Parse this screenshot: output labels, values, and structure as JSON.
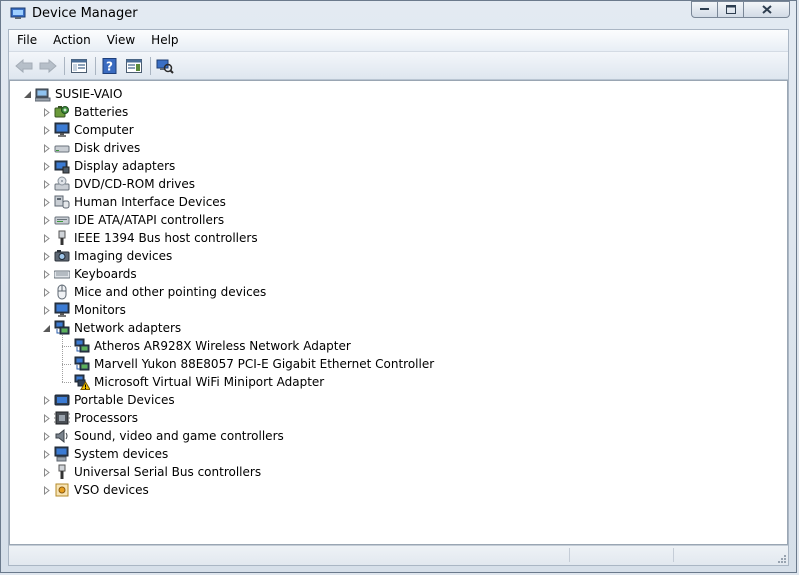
{
  "window": {
    "title": "Device Manager"
  },
  "menu": [
    "File",
    "Action",
    "View",
    "Help"
  ],
  "toolbar": {
    "buttons": [
      {
        "name": "back-button",
        "icon": "back-arrow-icon",
        "enabled": false
      },
      {
        "name": "forward-button",
        "icon": "forward-arrow-icon",
        "enabled": false
      },
      {
        "name": "show-hide-console-tree-button",
        "icon": "console-tree-icon",
        "enabled": true
      },
      {
        "name": "help-button",
        "icon": "help-icon",
        "enabled": true
      },
      {
        "name": "show-action-pane-button",
        "icon": "properties-icon",
        "enabled": true
      },
      {
        "name": "scan-hardware-button",
        "icon": "scan-hardware-icon",
        "enabled": true
      }
    ]
  },
  "tree": {
    "root": {
      "label": "SUSIE-VAIO",
      "icon": "computer-icon",
      "expanded": true
    },
    "categories": [
      {
        "label": "Batteries",
        "icon": "battery-icon"
      },
      {
        "label": "Computer",
        "icon": "monitor-icon"
      },
      {
        "label": "Disk drives",
        "icon": "disk-drive-icon"
      },
      {
        "label": "Display adapters",
        "icon": "display-adapter-icon"
      },
      {
        "label": "DVD/CD-ROM drives",
        "icon": "dvd-drive-icon"
      },
      {
        "label": "Human Interface Devices",
        "icon": "hid-icon"
      },
      {
        "label": "IDE ATA/ATAPI controllers",
        "icon": "ide-controller-icon"
      },
      {
        "label": "IEEE 1394 Bus host controllers",
        "icon": "firewire-icon"
      },
      {
        "label": "Imaging devices",
        "icon": "camera-icon"
      },
      {
        "label": "Keyboards",
        "icon": "keyboard-icon"
      },
      {
        "label": "Mice and other pointing devices",
        "icon": "mouse-icon"
      },
      {
        "label": "Monitors",
        "icon": "monitor-icon"
      },
      {
        "label": "Network adapters",
        "icon": "network-adapter-icon",
        "expanded": true,
        "children": [
          {
            "label": "Atheros AR928X Wireless Network Adapter",
            "icon": "network-adapter-icon"
          },
          {
            "label": "Marvell Yukon 88E8057 PCI-E Gigabit Ethernet Controller",
            "icon": "network-adapter-icon"
          },
          {
            "label": "Microsoft Virtual WiFi Miniport Adapter",
            "icon": "network-adapter-warning-icon",
            "warning": true
          }
        ]
      },
      {
        "label": "Portable Devices",
        "icon": "portable-device-icon"
      },
      {
        "label": "Processors",
        "icon": "processor-icon"
      },
      {
        "label": "Sound, video and game controllers",
        "icon": "speaker-icon"
      },
      {
        "label": "System devices",
        "icon": "system-device-icon"
      },
      {
        "label": "Universal Serial Bus controllers",
        "icon": "usb-icon"
      },
      {
        "label": "VSO devices",
        "icon": "vso-device-icon"
      }
    ]
  },
  "colors": {
    "tree_line": "#a0a0a0",
    "warning": "#f2c200",
    "accent": "#2a5caa"
  }
}
